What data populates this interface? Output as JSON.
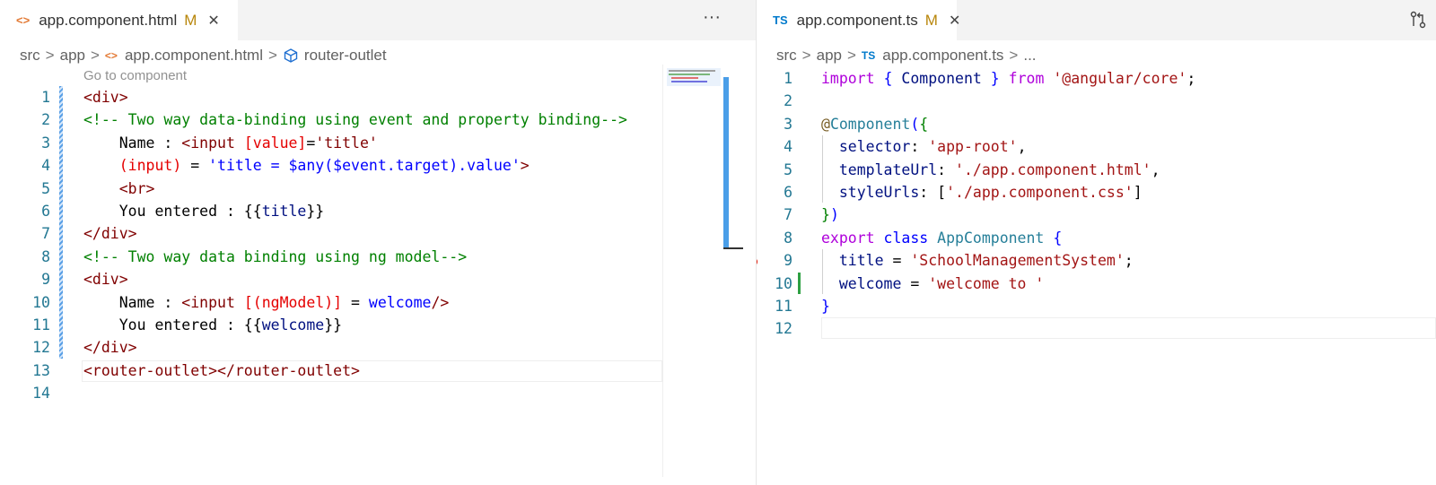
{
  "left": {
    "tab": {
      "icon": "<>",
      "label": "app.component.html",
      "modified": "M",
      "close": "✕"
    },
    "more": "···",
    "breadcrumb": {
      "p1": "src",
      "p2": "app",
      "p3": "app.component.html",
      "p4": "router-outlet"
    },
    "codelens": "Go to component",
    "lines": [
      [
        [
          "tag",
          "<div>"
        ]
      ],
      [
        [
          "cmt",
          "<!-- Two way data-binding using event and property binding-->"
        ]
      ],
      [
        [
          "plain",
          "    Name : "
        ],
        [
          "tag",
          "<input "
        ],
        [
          "attr",
          "[value]"
        ],
        [
          "plain",
          "="
        ],
        [
          "tag",
          "'title'"
        ]
      ],
      [
        [
          "attr",
          "    (input)"
        ],
        [
          "plain",
          " = "
        ],
        [
          "str",
          "'title = $any($event.target).value'"
        ],
        [
          "tag",
          ">"
        ]
      ],
      [
        [
          "tag",
          "    <br>"
        ]
      ],
      [
        [
          "plain",
          "    You entered : {{"
        ],
        [
          "prop",
          "title"
        ],
        [
          "plain",
          "}}"
        ]
      ],
      [
        [
          "tag",
          "</div>"
        ]
      ],
      [
        [
          "cmt",
          "<!-- Two way data binding using ng model-->"
        ]
      ],
      [
        [
          "tag",
          "<div>"
        ]
      ],
      [
        [
          "plain",
          "    Name : "
        ],
        [
          "tag",
          "<input "
        ],
        [
          "attr",
          "[(ngModel)]"
        ],
        [
          "plain",
          " = "
        ],
        [
          "str",
          "welcome"
        ],
        [
          "tag",
          "/>"
        ]
      ],
      [
        [
          "plain",
          "    You entered : {{"
        ],
        [
          "prop",
          "welcome"
        ],
        [
          "plain",
          "}}"
        ]
      ],
      [
        [
          "tag",
          "</div>"
        ]
      ],
      [
        [
          "tag",
          "<router-outlet></router-outlet>"
        ]
      ],
      []
    ],
    "line_numbers": [
      "1",
      "2",
      "3",
      "4",
      "5",
      "6",
      "7",
      "8",
      "9",
      "10",
      "11",
      "12",
      "13",
      "14"
    ]
  },
  "right": {
    "tab": {
      "icon": "TS",
      "label": "app.component.ts",
      "modified": "M",
      "close": "✕"
    },
    "breadcrumb": {
      "p1": "src",
      "p2": "app",
      "p3": "app.component.ts",
      "p4": "..."
    },
    "lines": [
      [
        [
          "kw2",
          "import"
        ],
        [
          "plain",
          " "
        ],
        [
          "kw",
          "{"
        ],
        [
          "plain",
          " "
        ],
        [
          "prop",
          "Component"
        ],
        [
          "plain",
          " "
        ],
        [
          "kw",
          "}"
        ],
        [
          "plain",
          " "
        ],
        [
          "kw2",
          "from"
        ],
        [
          "plain",
          " "
        ],
        [
          "tstr",
          "'@angular/core'"
        ],
        [
          "plain",
          ";"
        ]
      ],
      [],
      [
        [
          "dec",
          "@"
        ],
        [
          "cls",
          "Component"
        ],
        [
          "kw",
          "("
        ],
        [
          "cmt",
          "{"
        ]
      ],
      [
        [
          "prop",
          "  selector"
        ],
        [
          "plain",
          ": "
        ],
        [
          "tstr",
          "'app-root'"
        ],
        [
          "plain",
          ","
        ]
      ],
      [
        [
          "prop",
          "  templateUrl"
        ],
        [
          "plain",
          ": "
        ],
        [
          "tstr",
          "'./app.component.html'"
        ],
        [
          "plain",
          ","
        ]
      ],
      [
        [
          "prop",
          "  styleUrls"
        ],
        [
          "plain",
          ": ["
        ],
        [
          "tstr",
          "'./app.component.css'"
        ],
        [
          "plain",
          "]"
        ]
      ],
      [
        [
          "cmt",
          "}"
        ],
        [
          "kw",
          ")"
        ]
      ],
      [
        [
          "kw2",
          "export"
        ],
        [
          "plain",
          " "
        ],
        [
          "kw",
          "class"
        ],
        [
          "plain",
          " "
        ],
        [
          "cls",
          "AppComponent"
        ],
        [
          "plain",
          " "
        ],
        [
          "kw",
          "{"
        ]
      ],
      [
        [
          "prop",
          "  title"
        ],
        [
          "plain",
          " = "
        ],
        [
          "tstr",
          "'SchoolManagementSystem'"
        ],
        [
          "plain",
          ";"
        ]
      ],
      [
        [
          "prop",
          "  welcome"
        ],
        [
          "plain",
          " = "
        ],
        [
          "tstr",
          "'welcome to '"
        ]
      ],
      [
        [
          "kw",
          "}"
        ]
      ],
      []
    ],
    "line_numbers": [
      "1",
      "2",
      "3",
      "4",
      "5",
      "6",
      "7",
      "8",
      "9",
      "10",
      "11",
      "12"
    ]
  },
  "colors": {
    "accent": "#007acc",
    "breakpoint": "#e51400"
  }
}
